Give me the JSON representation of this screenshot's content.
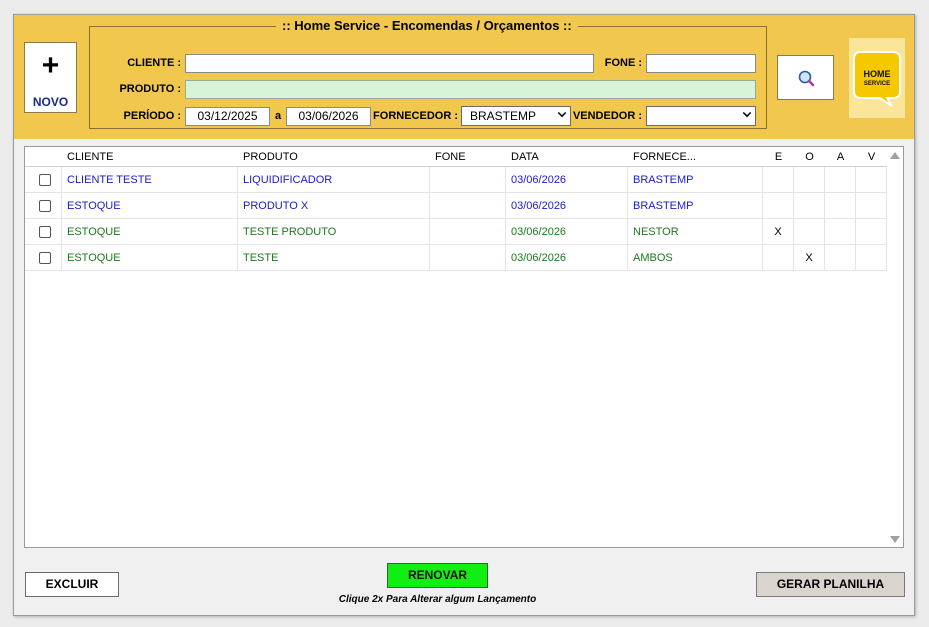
{
  "toolbar": {
    "novo_symbol": "+",
    "novo_label": "NOVO"
  },
  "filters": {
    "title": ":: Home Service - Encomendas / Orçamentos ::",
    "cliente_label": "CLIENTE :",
    "cliente_value": "",
    "fone_label": "FONE :",
    "fone_value": "",
    "produto_label": "PRODUTO :",
    "produto_value": "",
    "periodo_label": "PERÍODO :",
    "periodo_start": "03/12/2025",
    "periodo_sep": "a",
    "periodo_end": "03/06/2026",
    "fornecedor_label": "FORNECEDOR :",
    "fornecedor_selected": "BRASTEMP",
    "vendedor_label": "VENDEDOR :",
    "vendedor_selected": ""
  },
  "logo": {
    "line1": "HOME",
    "line2": "SERVICE"
  },
  "table": {
    "columns": [
      "CLIENTE",
      "PRODUTO",
      "FONE",
      "DATA",
      "FORNECE...",
      "E",
      "O",
      "A",
      "V"
    ],
    "rows": [
      {
        "cliente": "CLIENTE TESTE",
        "produto": "LIQUIDIFICADOR",
        "fone": "",
        "data": "03/06/2026",
        "fornecedor": "BRASTEMP",
        "e": "",
        "o": "",
        "a": "",
        "v": "",
        "color": "blue"
      },
      {
        "cliente": "ESTOQUE",
        "produto": "PRODUTO X",
        "fone": "",
        "data": "03/06/2026",
        "fornecedor": "BRASTEMP",
        "e": "",
        "o": "",
        "a": "",
        "v": "",
        "color": "blue"
      },
      {
        "cliente": "ESTOQUE",
        "produto": "TESTE PRODUTO",
        "fone": "",
        "data": "03/06/2026",
        "fornecedor": "NESTOR",
        "e": "X",
        "o": "",
        "a": "",
        "v": "",
        "color": "green"
      },
      {
        "cliente": "ESTOQUE",
        "produto": "TESTE",
        "fone": "",
        "data": "03/06/2026",
        "fornecedor": "AMBOS",
        "e": "",
        "o": "X",
        "a": "",
        "v": "",
        "color": "green"
      }
    ]
  },
  "footer": {
    "excluir_label": "EXCLUIR",
    "renovar_label": "RENOVAR",
    "hint": "Clique 2x Para Alterar algum Lançamento",
    "gerar_label": "GERAR PLANILHA"
  },
  "colors": {
    "header_bg": "#f1c74d",
    "renovar_bg": "#11ee11",
    "produto_field_bg": "#d8f4d8",
    "row_blue": "#1a1acc",
    "row_green": "#1a7a1a"
  }
}
